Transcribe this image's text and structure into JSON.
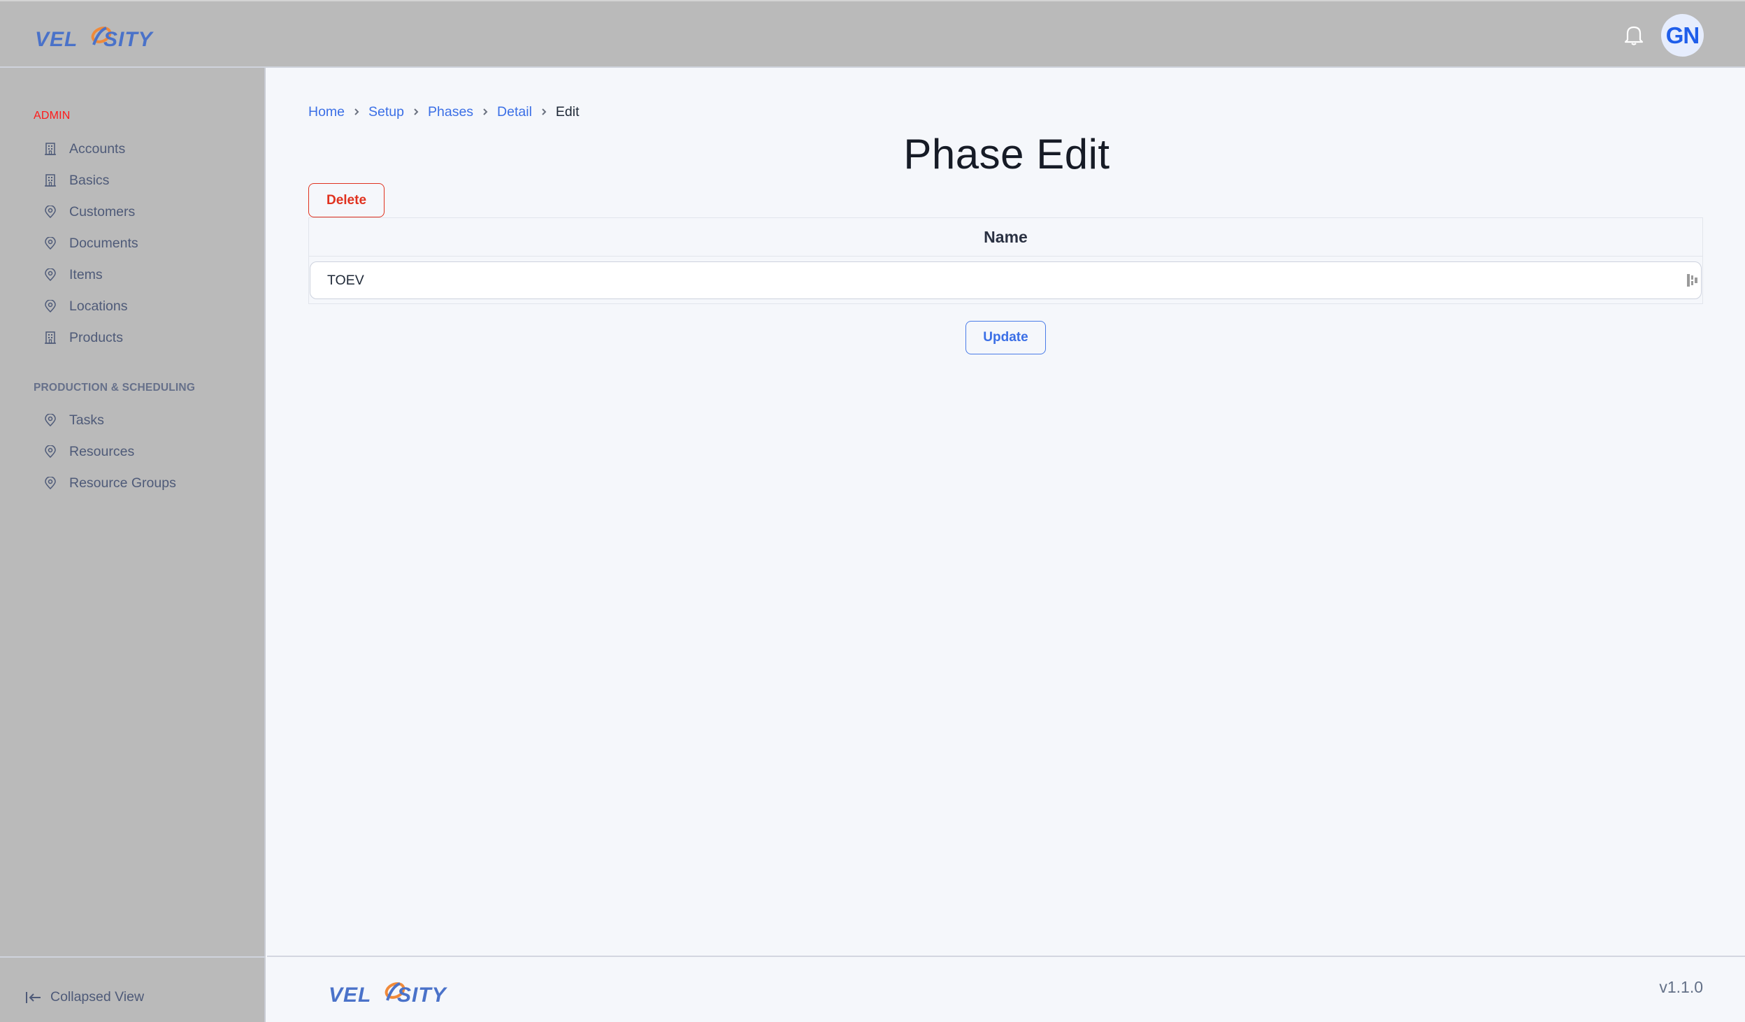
{
  "header": {
    "logo_text": "VELOSITY",
    "icons": {
      "notifications": "bell-icon"
    },
    "user": {
      "initials": "GN"
    }
  },
  "sidebar": {
    "sections": [
      {
        "label": "ADMIN",
        "items": [
          {
            "label": "Accounts",
            "icon": "building-icon"
          },
          {
            "label": "Basics",
            "icon": "building-icon"
          },
          {
            "label": "Customers",
            "icon": "map-pin-icon"
          },
          {
            "label": "Documents",
            "icon": "map-pin-icon"
          },
          {
            "label": "Items",
            "icon": "map-pin-icon"
          },
          {
            "label": "Locations",
            "icon": "map-pin-icon"
          },
          {
            "label": "Products",
            "icon": "building-icon"
          }
        ]
      },
      {
        "label": "PRODUCTION & SCHEDULING",
        "items": [
          {
            "label": "Tasks",
            "icon": "map-pin-icon"
          },
          {
            "label": "Resources",
            "icon": "map-pin-icon"
          },
          {
            "label": "Resource Groups",
            "icon": "map-pin-icon"
          }
        ]
      }
    ],
    "collapse_label": "Collapsed View"
  },
  "breadcrumb": [
    "Home",
    "Setup",
    "Phases",
    "Detail",
    "Edit"
  ],
  "page": {
    "title": "Phase Edit",
    "delete_label": "Delete",
    "update_label": "Update",
    "table": {
      "header": "Name",
      "name_value": "TOEV"
    }
  },
  "footer": {
    "logo_text": "VELOSITY",
    "version": "v1.1.0"
  },
  "colors": {
    "accent": "#3b6fe6",
    "danger": "#e0321f",
    "admin_label": "#ff1a1a",
    "sidebar_bg": "#bababa"
  }
}
